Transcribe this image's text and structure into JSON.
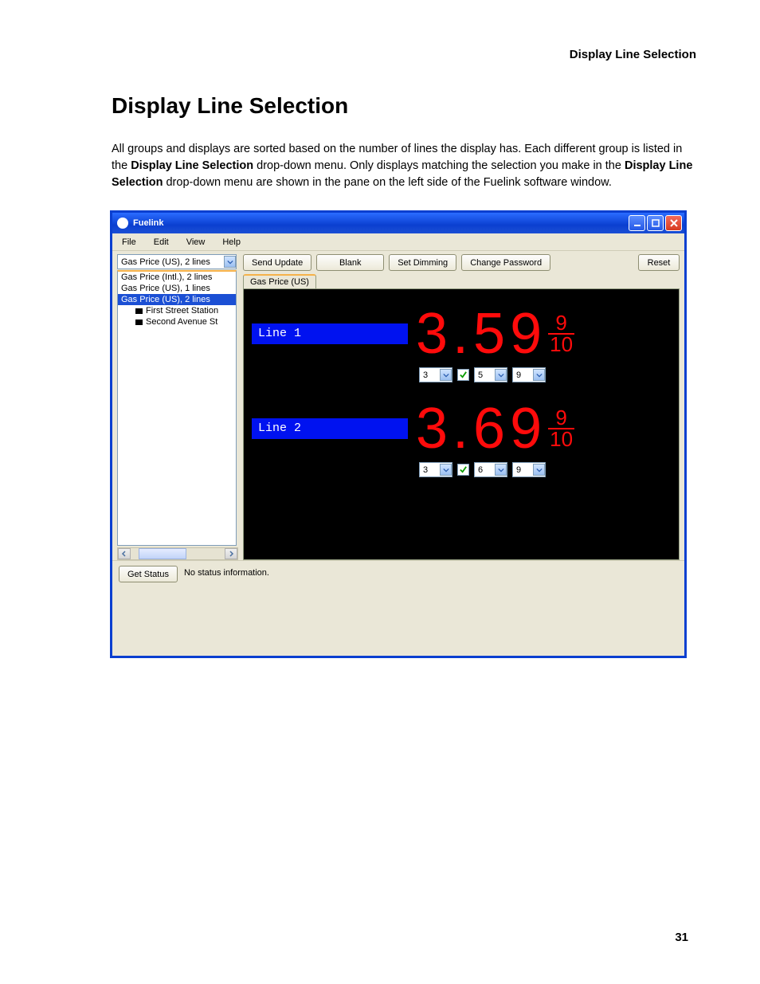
{
  "doc": {
    "header_right": "Display Line Selection",
    "title": "Display Line Selection",
    "para_a": "All groups and displays are sorted based on the number of lines the display has. Each different group is listed in the ",
    "bold1": "Display Line Selection",
    "para_b": " drop-down menu. Only displays matching the selection you make in the ",
    "bold2": "Display Line Selection",
    "para_c": " drop-down menu are shown in the pane on the left side of the Fuelink software window.",
    "page_num": "31"
  },
  "app": {
    "title": "Fuelink",
    "menu": {
      "file": "File",
      "edit": "Edit",
      "view": "View",
      "help": "Help"
    },
    "combo_selected": "Gas Price (US), 2 lines",
    "tree": {
      "i0": "Gas Price (Intl.), 2 lines",
      "i1": "Gas Price (US), 1 lines",
      "i2_sel": "Gas Price (US), 2 lines",
      "c0": "First Street Station",
      "c1": "Second Avenue St"
    },
    "toolbar": {
      "send": "Send Update",
      "blank": "Blank",
      "dim": "Set Dimming",
      "pwd": "Change Password",
      "reset": "Reset"
    },
    "tab": "Gas Price (US)",
    "lines": {
      "l1_label": "Line 1",
      "l1_price": "3.59",
      "l1_frac_n": "9",
      "l1_frac_d": "10",
      "l1_s1": "3",
      "l1_s2": "5",
      "l1_s3": "9",
      "l2_label": "Line 2",
      "l2_price": "3.69",
      "l2_frac_n": "9",
      "l2_frac_d": "10",
      "l2_s1": "3",
      "l2_s2": "6",
      "l2_s3": "9"
    },
    "status": {
      "get": "Get Status",
      "msg": "No status information."
    }
  }
}
